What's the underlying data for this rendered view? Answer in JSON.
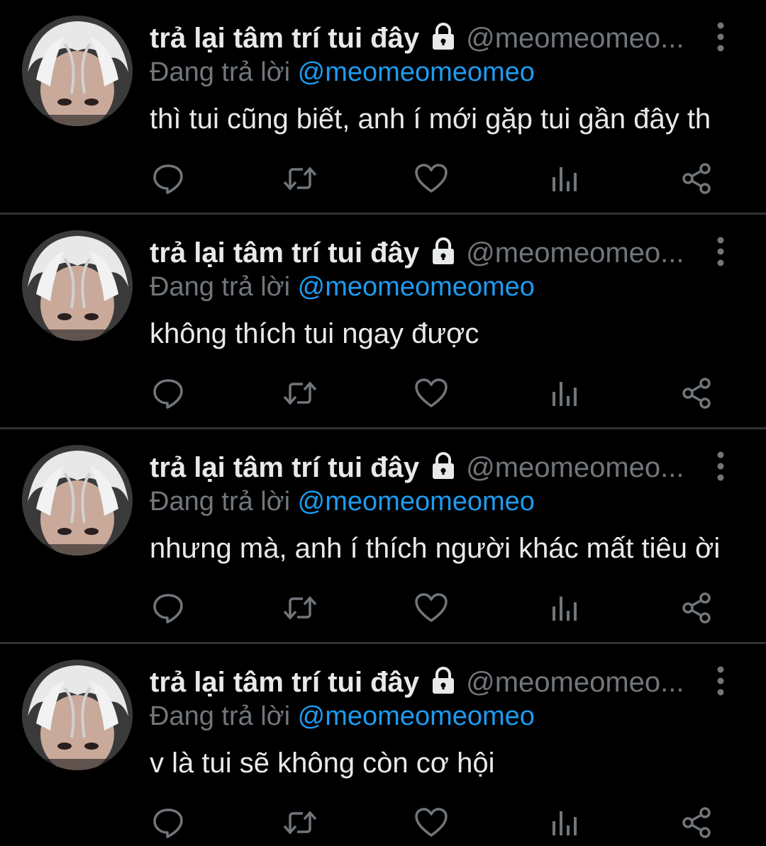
{
  "colors": {
    "background": "#000000",
    "text_primary": "#e7e9ea",
    "text_secondary": "#71767b",
    "accent": "#1d9bf0",
    "divider": "#2f3336"
  },
  "icons": {
    "lock": "lock-icon",
    "more": "more-vertical-icon",
    "reply": "reply-icon",
    "retweet": "retweet-icon",
    "like": "heart-icon",
    "views": "views-bar-chart-icon",
    "share": "share-icon"
  },
  "tweets": [
    {
      "display_name": "trả lại tâm trí tui đây",
      "handle": "@meomeomeo...",
      "reply_prefix": "Đang trả lời",
      "reply_to": "@meomeomeomeo",
      "text": "thì tui cũng biết, anh í mới gặp tui gần đây th"
    },
    {
      "display_name": "trả lại tâm trí tui đây",
      "handle": "@meomeomeo...",
      "reply_prefix": "Đang trả lời",
      "reply_to": "@meomeomeomeo",
      "text": "không thích tui ngay được"
    },
    {
      "display_name": "trả lại tâm trí tui đây",
      "handle": "@meomeomeo...",
      "reply_prefix": "Đang trả lời",
      "reply_to": "@meomeomeomeo",
      "text": "nhưng mà, anh í thích người khác mất tiêu ời"
    },
    {
      "display_name": "trả lại tâm trí tui đây",
      "handle": "@meomeomeo...",
      "reply_prefix": "Đang trả lời",
      "reply_to": "@meomeomeomeo",
      "text": "v là tui sẽ không còn cơ hội"
    }
  ]
}
